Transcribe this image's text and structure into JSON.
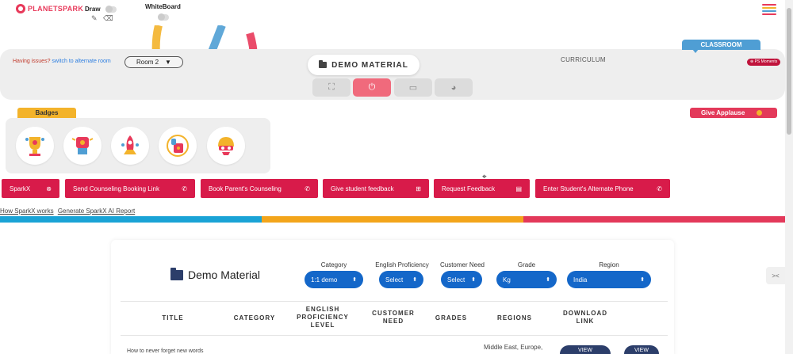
{
  "brand": {
    "name": "PLANETSPARK"
  },
  "topbar": {
    "draw_label": "Draw",
    "whiteboard_label": "WhiteBoard",
    "icons": [
      "pencil-icon",
      "eraser-icon",
      "hamburger-menu-icon"
    ],
    "hamburger_colors": [
      "#e8395a",
      "#f3b32b",
      "#4f9ed4",
      "#e8395a"
    ]
  },
  "classroom": {
    "issues_text": "Having issues?",
    "switch_link": "switch to alternate room",
    "room_value": "Room 2",
    "demo_material_label": "DEMO MATERIAL",
    "curriculum_label": "CURRICULUM",
    "classroom_tab": "CLASSROOM",
    "ps_moments": "PS Moments",
    "controls": [
      "fullscreen-icon",
      "power-icon",
      "laptop-icon",
      "palette-icon"
    ]
  },
  "badges": {
    "tab_label": "Badges",
    "items": [
      "trophy-badge",
      "fist-badge",
      "rocket-badge",
      "mic-badge",
      "helmet-badge"
    ]
  },
  "applause": {
    "label": "Give Applause"
  },
  "actions": [
    {
      "label": "SparkX",
      "icon": "close-circle-icon"
    },
    {
      "label": "Send Counseling Booking Link",
      "icon": "phone-icon"
    },
    {
      "label": "Book Parent's Counseling",
      "icon": "phone-icon"
    },
    {
      "label": "Give student feedback",
      "icon": "plus-square-icon"
    },
    {
      "label": "Request Feedback",
      "icon": "document-icon"
    },
    {
      "label": "Enter Student's Alternate Phone",
      "icon": "phone-icon"
    }
  ],
  "links": {
    "how": "How SparkX works",
    "generate": "Generate SparkX AI Report"
  },
  "stripe_colors": [
    "#1aa3d6",
    "#f3a51b",
    "#e3395a"
  ],
  "demo_card": {
    "title": "Demo Material",
    "filters": [
      {
        "label": "Category",
        "value": "1:1 demo"
      },
      {
        "label": "English Proficiency",
        "value": "Select"
      },
      {
        "label": "Customer Need",
        "value": "Select"
      },
      {
        "label": "Grade",
        "value": "Kg"
      },
      {
        "label": "Region",
        "value": "India"
      }
    ],
    "columns": [
      "TITLE",
      "CATEGORY",
      "ENGLISH PROFICIENCY LEVEL",
      "CUSTOMER NEED",
      "GRADES",
      "REGIONS",
      "DOWNLOAD LINK"
    ],
    "rows": [
      {
        "title": "How to never forget new words",
        "regions": "Middle East, Europe,",
        "download": "VIEW",
        "view": "VIEW"
      }
    ]
  }
}
